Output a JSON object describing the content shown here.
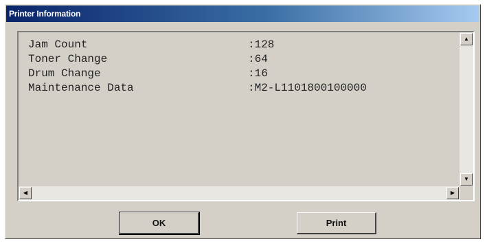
{
  "window": {
    "title": "Printer Information"
  },
  "info": {
    "rows": [
      {
        "label": "Jam Count",
        "value": ":128"
      },
      {
        "label": "Toner Change",
        "value": ":64"
      },
      {
        "label": "Drum Change",
        "value": ":16"
      },
      {
        "label": "Maintenance Data",
        "value": ":M2-L1101800100000"
      }
    ]
  },
  "buttons": {
    "ok_label": "OK",
    "print_label": "Print"
  },
  "icons": {
    "scroll_up": "scroll-up-arrow-icon",
    "scroll_down": "scroll-down-arrow-icon",
    "scroll_left": "scroll-left-arrow-icon",
    "scroll_right": "scroll-right-arrow-icon"
  },
  "colors": {
    "title_gradient_start": "#0a246a",
    "title_gradient_end": "#a6caf0",
    "dialog_face": "#d4d0c8"
  }
}
